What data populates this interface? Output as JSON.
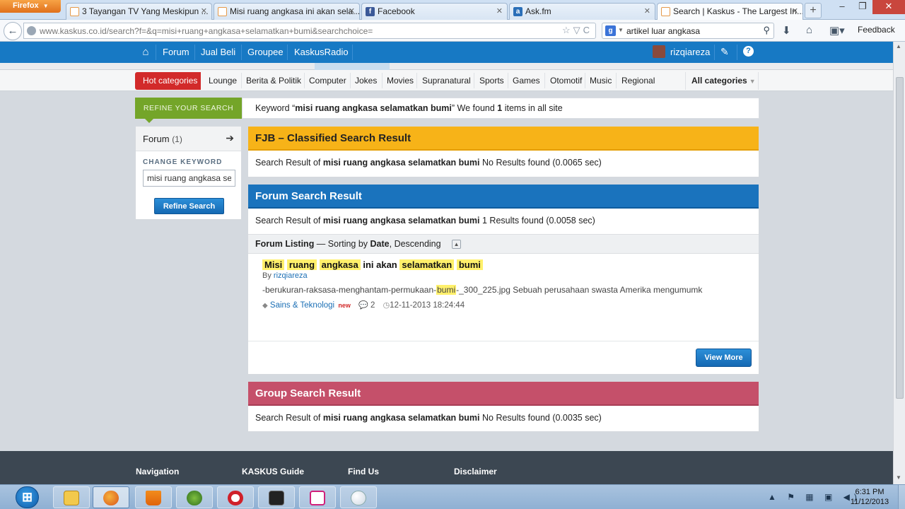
{
  "browser": {
    "app_button": "Firefox",
    "tabs": [
      {
        "title": "3 Tayangan TV Yang Meskipun ..."
      },
      {
        "title": "Misi ruang angkasa ini akan sela..."
      },
      {
        "title": "Facebook"
      },
      {
        "title": "Ask.fm"
      },
      {
        "title": "Search | Kaskus - The Largest In..."
      }
    ],
    "active_tab": 4,
    "url": "www.kaskus.co.id/search?f=&q=misi+ruang+angkasa+selamatkan+bumi&searchchoice=",
    "search_value": "artikel luar angkasa",
    "search_engine_icon": "google-icon",
    "feedback_label": "Feedback"
  },
  "site": {
    "topnav": [
      "Forum",
      "Jual Beli",
      "Groupee",
      "KaskusRadio"
    ],
    "username": "rizqiareza",
    "hot_categories_label": "Hot categories",
    "categories": [
      "Lounge",
      "Berita & Politik",
      "Computer",
      "Jokes",
      "Movies",
      "Supranatural",
      "Sports",
      "Games",
      "Otomotif",
      "Music",
      "Regional"
    ],
    "all_categories_label": "All categories"
  },
  "search": {
    "refine_tab_label": "REFINE YOUR SEARCH",
    "keyword_prefix": "Keyword “",
    "keyword": "misi ruang angkasa selamatkan bumi",
    "keyword_suffix_1": "” We found ",
    "found_count": "1",
    "keyword_suffix_2": " items in all site"
  },
  "sidebar": {
    "forum_label": "Forum",
    "forum_count": "(1)",
    "change_keyword_label": "CHANGE KEYWORD",
    "keyword_value": "misi ruang angkasa selamatkan bumi",
    "refine_button": "Refine Search"
  },
  "fjb": {
    "title": "FJB – Classified Search Result",
    "result_prefix": "Search Result of ",
    "result_suffix": "  No Results found (0.0065 sec)"
  },
  "forum": {
    "title": "Forum Search Result",
    "result_prefix": "Search Result of ",
    "result_suffix": " 1 Results found (0.0058 sec)",
    "listing_label": "Forum Listing",
    "sorting_text_1": " — Sorting by ",
    "sorting_field": "Date",
    "sorting_text_2": ", Descending",
    "item": {
      "title_words": [
        "Misi",
        "ruang",
        "angkasa"
      ],
      "title_mid": "ini akan",
      "title_words_2": [
        "selamatkan",
        "bumi"
      ],
      "by_label": "By ",
      "author": "rizqiareza",
      "snippet_pre": "-berukuran-raksasa-menghantam-permukaan-",
      "snippet_hl": "bumi",
      "snippet_post": "-_300_225.jpg Sebuah perusahaan swasta Amerika mengumumk",
      "category": "Sains & Teknologi",
      "new_label": "new",
      "comments": "2",
      "datetime": "12-11-2013 18:24:44"
    },
    "view_more": "View More"
  },
  "group": {
    "title": "Group Search Result",
    "result_prefix": "Search Result of ",
    "result_suffix": " No Results found (0.0035 sec)"
  },
  "footer": {
    "headings": [
      "Navigation",
      "KASKUS Guide",
      "Find Us",
      "Disclaimer"
    ]
  },
  "taskbar": {
    "time": "6:31 PM",
    "date": "11/12/2013"
  }
}
